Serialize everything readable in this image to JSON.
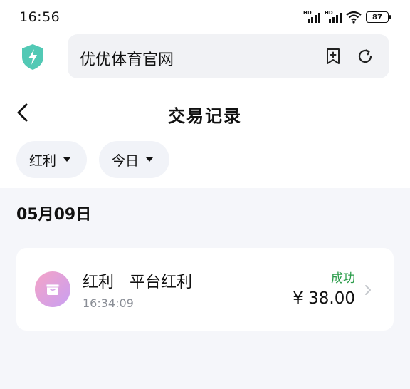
{
  "status_bar": {
    "time": "16:56",
    "signal_1_label": "HD",
    "signal_2_label": "HD",
    "battery": "87"
  },
  "browser": {
    "url_text": "优优体育官网",
    "shield_icon": "shield-bolt-icon",
    "accent": "#52c9b5"
  },
  "page": {
    "title": "交易记录",
    "filters": [
      {
        "label": "红利"
      },
      {
        "label": "今日"
      }
    ],
    "date_heading": "05月09日"
  },
  "records": [
    {
      "title": "红利　平台红利",
      "time": "16:34:09",
      "status": "成功",
      "status_color": "#2a9c4a",
      "amount": "¥ 38.00"
    }
  ]
}
